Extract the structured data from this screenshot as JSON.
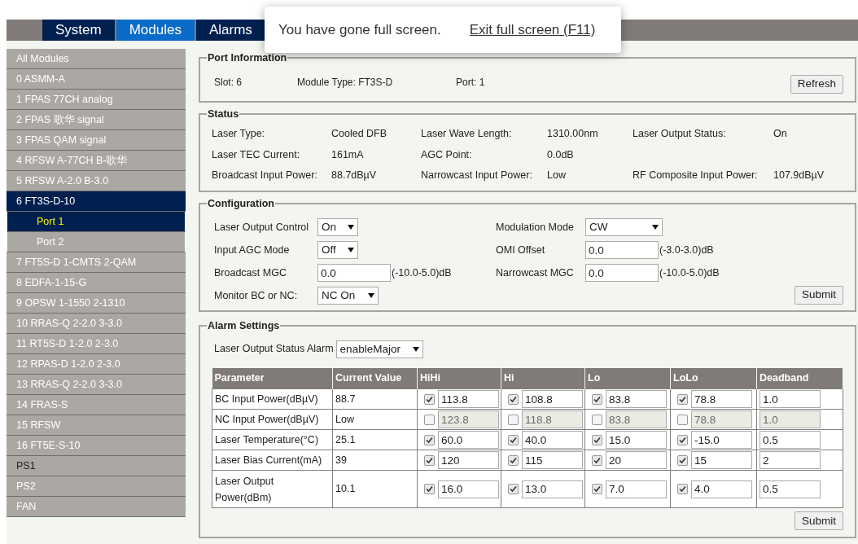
{
  "nav": {
    "tabs": [
      {
        "label": "System",
        "selected": false
      },
      {
        "label": "Modules",
        "selected": true
      },
      {
        "label": "Alarms",
        "selected": false
      }
    ]
  },
  "fullscreen_notice": {
    "message": "You have gone full screen.",
    "link": "Exit full screen (F11)"
  },
  "sidebar": {
    "items": [
      {
        "label": "All Modules",
        "selected": false,
        "hovered": false
      },
      {
        "label": "0 ASMM-A",
        "selected": false,
        "hovered": false
      },
      {
        "label": "1 FPAS 77CH analog",
        "selected": false,
        "hovered": false
      },
      {
        "label": "2 FPAS 歌华 signal",
        "selected": false,
        "hovered": false
      },
      {
        "label": "3 FPAS QAM signal",
        "selected": false,
        "hovered": false
      },
      {
        "label": "4 RFSW A-77CH B-歌华",
        "selected": false,
        "hovered": false
      },
      {
        "label": "5 RFSW A-2.0 B-3.0",
        "selected": false,
        "hovered": false
      },
      {
        "label": "6 FT3S-D-10",
        "selected": true,
        "hovered": false,
        "children": [
          {
            "label": "Port 1",
            "selected": true
          },
          {
            "label": "Port 2",
            "selected": false
          }
        ]
      },
      {
        "label": "7 FT5S-D 1-CMTS 2-QAM",
        "selected": false,
        "hovered": false
      },
      {
        "label": "8 EDFA-1-15-G",
        "selected": false,
        "hovered": false
      },
      {
        "label": "9 OPSW 1-1550 2-1310",
        "selected": false,
        "hovered": false
      },
      {
        "label": "10 RRAS-Q 2-2.0 3-3.0",
        "selected": false,
        "hovered": false
      },
      {
        "label": "11 RT5S-D 1-2.0 2-3.0",
        "selected": false,
        "hovered": false
      },
      {
        "label": "12 RPAS-D 1-2.0 2-3.0",
        "selected": false,
        "hovered": false
      },
      {
        "label": "13 RRAS-Q 2-2.0 3-3.0",
        "selected": false,
        "hovered": false
      },
      {
        "label": "14 FRAS-S",
        "selected": false,
        "hovered": false
      },
      {
        "label": "15 RFSW",
        "selected": false,
        "hovered": false
      },
      {
        "label": "16 FT5E-S-10",
        "selected": false,
        "hovered": false
      },
      {
        "label": "PS1",
        "selected": false,
        "hovered": true
      },
      {
        "label": "PS2",
        "selected": false,
        "hovered": false
      },
      {
        "label": "FAN",
        "selected": false,
        "hovered": false
      }
    ]
  },
  "port_information": {
    "title": "Port Information",
    "slot": "Slot: 6",
    "module_type": "Module Type: FT3S-D",
    "port": "Port: 1",
    "button": "Refresh"
  },
  "status": {
    "title": "Status",
    "rows": [
      [
        {
          "label": "Laser Type:",
          "value": "Cooled DFB"
        },
        {
          "label": "Laser Wave Length:",
          "value": "1310.00nm"
        },
        {
          "label": "Laser Output Status:",
          "value": "On"
        }
      ],
      [
        {
          "label": "Laser TEC Current:",
          "value": "161mA"
        },
        {
          "label": "AGC Point:",
          "value": "0.0dB"
        }
      ],
      [
        {
          "label": "Broadcast Input Power:",
          "value": "88.7dBµV"
        },
        {
          "label": "Narrowcast Input Power:",
          "value": "Low"
        },
        {
          "label": "RF Composite Input Power:",
          "value": "107.9dBµV"
        }
      ]
    ]
  },
  "configuration": {
    "title": "Configuration",
    "left": [
      {
        "label": "Laser Output Control",
        "kind": "select",
        "value": "On"
      },
      {
        "label": "Input AGC Mode",
        "kind": "select",
        "value": "Off"
      },
      {
        "label": "Broadcast MGC",
        "kind": "input",
        "value": "0.0",
        "range": "(-10.0-5.0)dB"
      },
      {
        "label": "Monitor BC or NC:",
        "kind": "select",
        "value": "NC On"
      }
    ],
    "right": [
      {
        "label": "Modulation Mode",
        "kind": "select",
        "value": "CW"
      },
      {
        "label": "OMI Offset",
        "kind": "input",
        "value": "0.0",
        "range": "(-3.0-3.0)dB"
      },
      {
        "label": "Narrowcast MGC",
        "kind": "input",
        "value": "0.0",
        "range": "(-10.0-5.0)dB"
      }
    ],
    "button": "Submit"
  },
  "alarm_settings": {
    "title": "Alarm Settings",
    "status_alarm": {
      "label": "Laser Output Status Alarm",
      "value": "enableMajor"
    },
    "columns": [
      "Parameter",
      "Current Value",
      "HiHi",
      "Hi",
      "Lo",
      "LoLo",
      "Deadband"
    ],
    "rows": [
      {
        "parameter": "BC Input Power(dBµV)",
        "current": "88.7",
        "thresholds": [
          {
            "checked": true,
            "value": "113.8"
          },
          {
            "checked": true,
            "value": "108.8"
          },
          {
            "checked": true,
            "value": "83.8"
          },
          {
            "checked": true,
            "value": "78.8"
          }
        ],
        "deadband": {
          "value": "1.0",
          "disabled": false
        }
      },
      {
        "parameter": "NC Input Power(dBµV)",
        "current": "Low",
        "thresholds": [
          {
            "checked": false,
            "value": "123.8"
          },
          {
            "checked": false,
            "value": "118.8"
          },
          {
            "checked": false,
            "value": "83.8"
          },
          {
            "checked": false,
            "value": "78.8"
          }
        ],
        "deadband": {
          "value": "1.0",
          "disabled": true
        }
      },
      {
        "parameter": "Laser Temperature(°C)",
        "current": "25.1",
        "thresholds": [
          {
            "checked": true,
            "value": "60.0"
          },
          {
            "checked": true,
            "value": "40.0"
          },
          {
            "checked": true,
            "value": "15.0"
          },
          {
            "checked": true,
            "value": "-15.0"
          }
        ],
        "deadband": {
          "value": "0.5",
          "disabled": false
        }
      },
      {
        "parameter": "Laser Bias Current(mA)",
        "current": "39",
        "thresholds": [
          {
            "checked": true,
            "value": "120"
          },
          {
            "checked": true,
            "value": "115"
          },
          {
            "checked": true,
            "value": "20"
          },
          {
            "checked": true,
            "value": "15"
          }
        ],
        "deadband": {
          "value": "2",
          "disabled": false
        }
      },
      {
        "parameter": "Laser Output Power(dBm)",
        "current": "10.1",
        "thresholds": [
          {
            "checked": true,
            "value": "16.0"
          },
          {
            "checked": true,
            "value": "13.0"
          },
          {
            "checked": true,
            "value": "7.0"
          },
          {
            "checked": true,
            "value": "4.0"
          }
        ],
        "deadband": {
          "value": "0.5",
          "disabled": false
        }
      }
    ],
    "button": "Submit"
  }
}
